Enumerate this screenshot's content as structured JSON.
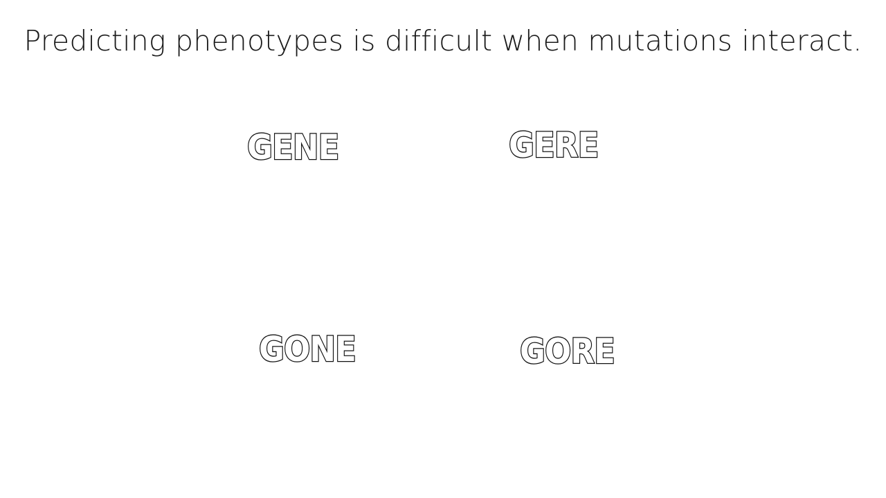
{
  "slide": {
    "title": "Predicting phenotypes is difficult when mutations interact.",
    "words": [
      "GENE",
      "GERE",
      "GONE",
      "GORE"
    ],
    "colors": {
      "background": "#ffffff",
      "text": "#1a1a1a",
      "outline": "#111111"
    }
  }
}
